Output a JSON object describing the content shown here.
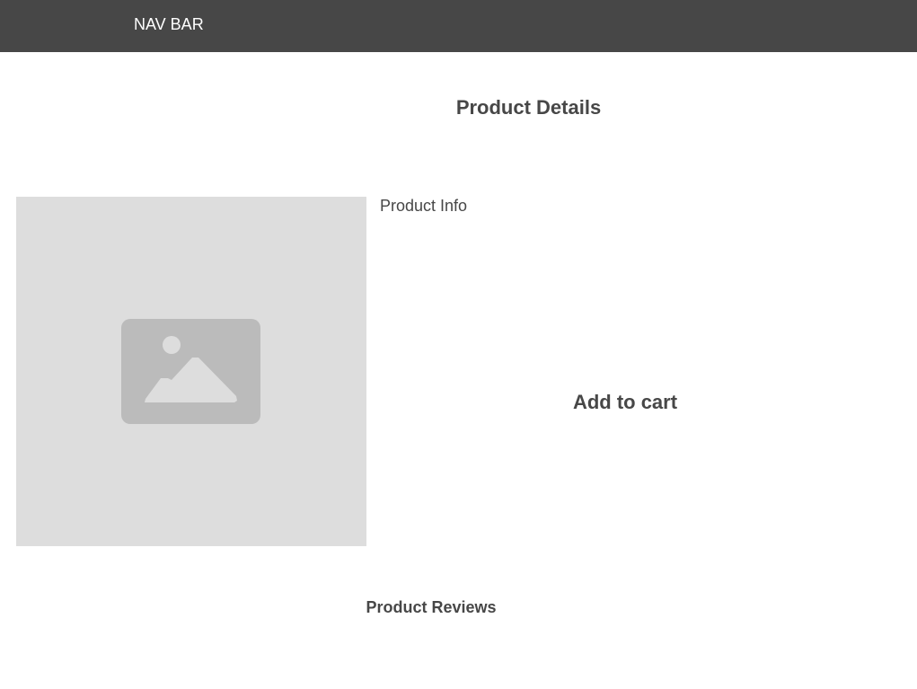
{
  "navbar": {
    "label": "NAV BAR"
  },
  "main": {
    "title": "Product Details",
    "product_image_icon": "image-placeholder-icon",
    "product_info_label": "Product Info",
    "add_to_cart_label": "Add to cart",
    "reviews_title": "Product Reviews"
  },
  "colors": {
    "navbar_bg": "#474747",
    "navbar_text": "#ffffff",
    "text": "#474747",
    "image_bg": "#dddddd",
    "image_icon": "#bbbbbb"
  }
}
